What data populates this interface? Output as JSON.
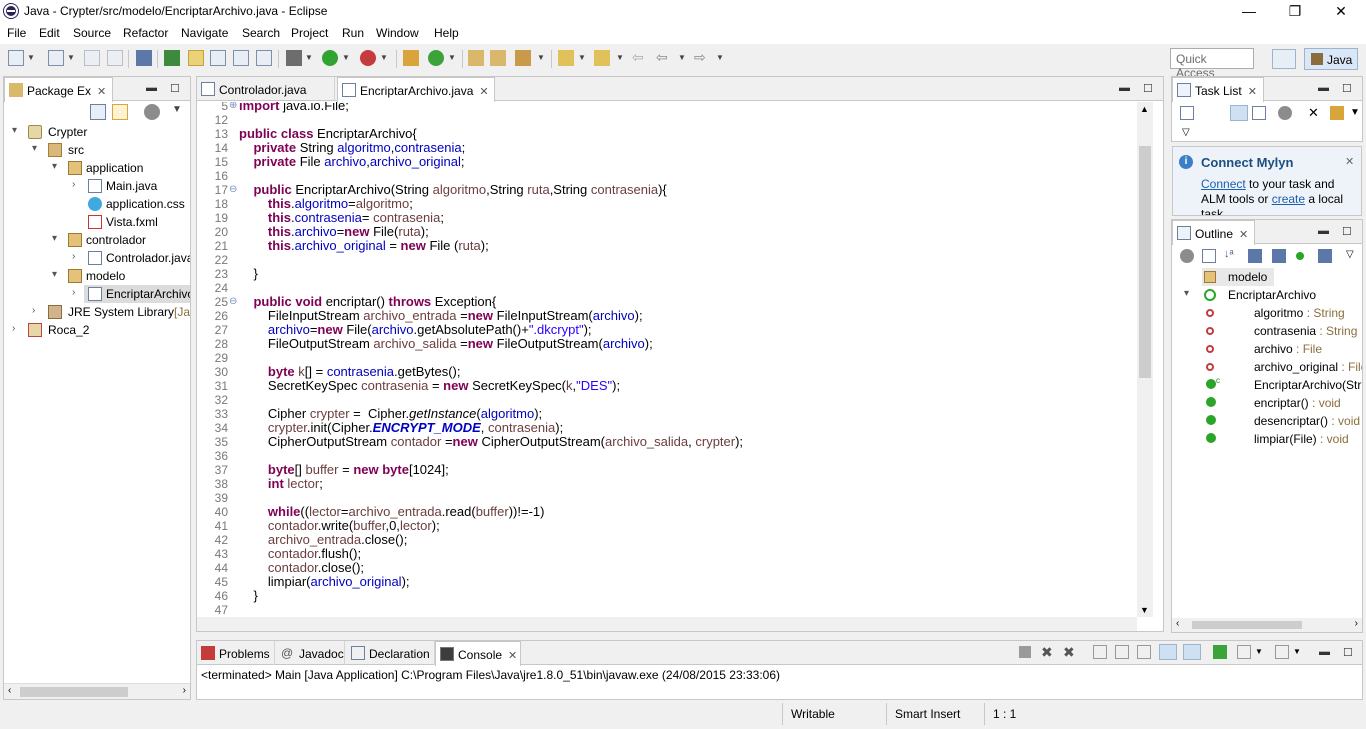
{
  "window": {
    "title": "Java - Crypter/src/modelo/EncriptarArchivo.java - Eclipse",
    "minimize": "—",
    "restore": "❐",
    "close": "✕"
  },
  "menu": [
    "File",
    "Edit",
    "Source",
    "Refactor",
    "Navigate",
    "Search",
    "Project",
    "Run",
    "Window",
    "Help"
  ],
  "quick_access": {
    "placeholder": "Quick Access"
  },
  "perspective": {
    "label": "Java"
  },
  "package_explorer": {
    "tab_label": "Package Ex",
    "tree": [
      {
        "label": "Crypter",
        "extra": "",
        "icon": "project-icon",
        "arrow": "▾"
      },
      {
        "label": "src",
        "extra": "",
        "icon": "source-folder-icon",
        "arrow": "▾"
      },
      {
        "label": "application",
        "extra": "",
        "icon": "package-icon",
        "arrow": "▾"
      },
      {
        "label": "Main.java",
        "extra": "",
        "icon": "java-file-icon",
        "arrow": "›"
      },
      {
        "label": "application.css",
        "extra": "",
        "icon": "css-file-icon",
        "arrow": ""
      },
      {
        "label": "Vista.fxml",
        "extra": "",
        "icon": "fxml-file-icon",
        "arrow": ""
      },
      {
        "label": "controlador",
        "extra": "",
        "icon": "package-icon",
        "arrow": "▾"
      },
      {
        "label": "Controlador.java",
        "extra": "",
        "icon": "java-file-icon",
        "arrow": "›"
      },
      {
        "label": "modelo",
        "extra": "",
        "icon": "package-icon",
        "arrow": "▾"
      },
      {
        "label": "EncriptarArchivo",
        "extra": "",
        "icon": "java-file-icon",
        "arrow": "›"
      },
      {
        "label": "JRE System Library",
        "extra": "[Java",
        "icon": "library-icon",
        "arrow": "›"
      },
      {
        "label": "Roca_2",
        "extra": "",
        "icon": "project-icon",
        "arrow": "›"
      }
    ]
  },
  "editor": {
    "tabs": [
      {
        "label": "Controlador.java",
        "active": false
      },
      {
        "label": "EncriptarArchivo.java",
        "active": true
      }
    ],
    "lines": [
      {
        "n": "5",
        "fold": "⊕",
        "segs": [
          [
            "kw",
            "import"
          ],
          [
            "t",
            " java.io.File;"
          ]
        ]
      },
      {
        "n": "12",
        "fold": "",
        "segs": []
      },
      {
        "n": "13",
        "fold": "",
        "segs": [
          [
            "kw",
            "public class"
          ],
          [
            "t",
            " EncriptarArchivo{"
          ]
        ]
      },
      {
        "n": "14",
        "fold": "",
        "segs": [
          [
            "t",
            "    "
          ],
          [
            "kw",
            "private"
          ],
          [
            "t",
            " String "
          ],
          [
            "fld",
            "algoritmo"
          ],
          [
            "t",
            ","
          ],
          [
            "fld",
            "contrasenia"
          ],
          [
            "t",
            ";"
          ]
        ]
      },
      {
        "n": "15",
        "fold": "",
        "segs": [
          [
            "t",
            "    "
          ],
          [
            "kw",
            "private"
          ],
          [
            "t",
            " File "
          ],
          [
            "fld",
            "archivo"
          ],
          [
            "t",
            ","
          ],
          [
            "fld",
            "archivo_original"
          ],
          [
            "t",
            ";"
          ]
        ]
      },
      {
        "n": "16",
        "fold": "",
        "segs": []
      },
      {
        "n": "17",
        "fold": "⊖",
        "segs": [
          [
            "t",
            "    "
          ],
          [
            "kw",
            "public"
          ],
          [
            "t",
            " EncriptarArchivo(String "
          ],
          [
            "prm",
            "algoritmo"
          ],
          [
            "t",
            ",String "
          ],
          [
            "prm",
            "ruta"
          ],
          [
            "t",
            ",String "
          ],
          [
            "prm",
            "contrasenia"
          ],
          [
            "t",
            "){"
          ]
        ]
      },
      {
        "n": "18",
        "fold": "",
        "segs": [
          [
            "t",
            "        "
          ],
          [
            "kw",
            "this"
          ],
          [
            "t",
            "."
          ],
          [
            "fld",
            "algoritmo"
          ],
          [
            "t",
            "="
          ],
          [
            "prm",
            "algoritmo"
          ],
          [
            "t",
            ";"
          ]
        ]
      },
      {
        "n": "19",
        "fold": "",
        "segs": [
          [
            "t",
            "        "
          ],
          [
            "kw",
            "this"
          ],
          [
            "t",
            "."
          ],
          [
            "fld",
            "contrasenia"
          ],
          [
            "t",
            "= "
          ],
          [
            "prm",
            "contrasenia"
          ],
          [
            "t",
            ";"
          ]
        ]
      },
      {
        "n": "20",
        "fold": "",
        "segs": [
          [
            "t",
            "        "
          ],
          [
            "kw",
            "this"
          ],
          [
            "t",
            "."
          ],
          [
            "fld",
            "archivo"
          ],
          [
            "t",
            "="
          ],
          [
            "kw",
            "new"
          ],
          [
            "t",
            " File("
          ],
          [
            "prm",
            "ruta"
          ],
          [
            "t",
            ");"
          ]
        ]
      },
      {
        "n": "21",
        "fold": "",
        "segs": [
          [
            "t",
            "        "
          ],
          [
            "kw",
            "this"
          ],
          [
            "t",
            "."
          ],
          [
            "fld",
            "archivo_original"
          ],
          [
            "t",
            " = "
          ],
          [
            "kw",
            "new"
          ],
          [
            "t",
            " File ("
          ],
          [
            "prm",
            "ruta"
          ],
          [
            "t",
            ");"
          ]
        ]
      },
      {
        "n": "22",
        "fold": "",
        "segs": []
      },
      {
        "n": "23",
        "fold": "",
        "segs": [
          [
            "t",
            "    }"
          ]
        ]
      },
      {
        "n": "24",
        "fold": "",
        "segs": []
      },
      {
        "n": "25",
        "fold": "⊖",
        "segs": [
          [
            "t",
            "    "
          ],
          [
            "kw",
            "public void"
          ],
          [
            "t",
            " encriptar() "
          ],
          [
            "kw",
            "throws"
          ],
          [
            "t",
            " Exception{"
          ]
        ]
      },
      {
        "n": "26",
        "fold": "",
        "segs": [
          [
            "t",
            "        FileInputStream "
          ],
          [
            "prm",
            "archivo_entrada"
          ],
          [
            "t",
            " ="
          ],
          [
            "kw",
            "new"
          ],
          [
            "t",
            " FileInputStream("
          ],
          [
            "fld",
            "archivo"
          ],
          [
            "t",
            ");"
          ]
        ]
      },
      {
        "n": "27",
        "fold": "",
        "segs": [
          [
            "t",
            "        "
          ],
          [
            "fld",
            "archivo"
          ],
          [
            "t",
            "="
          ],
          [
            "kw",
            "new"
          ],
          [
            "t",
            " File("
          ],
          [
            "fld",
            "archivo"
          ],
          [
            "t",
            ".getAbsolutePath()+"
          ],
          [
            "str",
            "\".dkcrypt\""
          ],
          [
            "t",
            ");"
          ]
        ]
      },
      {
        "n": "28",
        "fold": "",
        "segs": [
          [
            "t",
            "        FileOutputStream "
          ],
          [
            "prm",
            "archivo_salida"
          ],
          [
            "t",
            " ="
          ],
          [
            "kw",
            "new"
          ],
          [
            "t",
            " FileOutputStream("
          ],
          [
            "fld",
            "archivo"
          ],
          [
            "t",
            ");"
          ]
        ]
      },
      {
        "n": "29",
        "fold": "",
        "segs": []
      },
      {
        "n": "30",
        "fold": "",
        "segs": [
          [
            "t",
            "        "
          ],
          [
            "kw",
            "byte"
          ],
          [
            "t",
            " "
          ],
          [
            "prm",
            "k"
          ],
          [
            "t",
            "[] = "
          ],
          [
            "fld",
            "contrasenia"
          ],
          [
            "t",
            ".getBytes();"
          ]
        ]
      },
      {
        "n": "31",
        "fold": "",
        "segs": [
          [
            "t",
            "        SecretKeySpec "
          ],
          [
            "prm",
            "contrasenia"
          ],
          [
            "t",
            " = "
          ],
          [
            "kw",
            "new"
          ],
          [
            "t",
            " SecretKeySpec("
          ],
          [
            "prm",
            "k"
          ],
          [
            "t",
            ","
          ],
          [
            "str",
            "\"DES\""
          ],
          [
            "t",
            ");"
          ]
        ]
      },
      {
        "n": "32",
        "fold": "",
        "segs": []
      },
      {
        "n": "33",
        "fold": "",
        "segs": [
          [
            "t",
            "        Cipher "
          ],
          [
            "prm",
            "crypter"
          ],
          [
            "t",
            " =  Cipher."
          ],
          [
            "ital",
            "getInstance"
          ],
          [
            "t",
            "("
          ],
          [
            "fld",
            "algoritmo"
          ],
          [
            "t",
            ");"
          ]
        ]
      },
      {
        "n": "34",
        "fold": "",
        "segs": [
          [
            "t",
            "        "
          ],
          [
            "prm",
            "crypter"
          ],
          [
            "t",
            ".init(Cipher."
          ],
          [
            "sta",
            "ENCRYPT_MODE"
          ],
          [
            "t",
            ", "
          ],
          [
            "prm",
            "contrasenia"
          ],
          [
            "t",
            ");"
          ]
        ]
      },
      {
        "n": "35",
        "fold": "",
        "segs": [
          [
            "t",
            "        CipherOutputStream "
          ],
          [
            "prm",
            "contador"
          ],
          [
            "t",
            " ="
          ],
          [
            "kw",
            "new"
          ],
          [
            "t",
            " CipherOutputStream("
          ],
          [
            "prm",
            "archivo_salida"
          ],
          [
            "t",
            ", "
          ],
          [
            "prm",
            "crypter"
          ],
          [
            "t",
            ");"
          ]
        ]
      },
      {
        "n": "36",
        "fold": "",
        "segs": []
      },
      {
        "n": "37",
        "fold": "",
        "segs": [
          [
            "t",
            "        "
          ],
          [
            "kw",
            "byte"
          ],
          [
            "t",
            "[] "
          ],
          [
            "prm",
            "buffer"
          ],
          [
            "t",
            " = "
          ],
          [
            "kw",
            "new byte"
          ],
          [
            "t",
            "[1024];"
          ]
        ]
      },
      {
        "n": "38",
        "fold": "",
        "segs": [
          [
            "t",
            "        "
          ],
          [
            "kw",
            "int"
          ],
          [
            "t",
            " "
          ],
          [
            "prm",
            "lector"
          ],
          [
            "t",
            ";"
          ]
        ]
      },
      {
        "n": "39",
        "fold": "",
        "segs": []
      },
      {
        "n": "40",
        "fold": "",
        "segs": [
          [
            "t",
            "        "
          ],
          [
            "kw",
            "while"
          ],
          [
            "t",
            "(("
          ],
          [
            "prm",
            "lector"
          ],
          [
            "t",
            "="
          ],
          [
            "prm",
            "archivo_entrada"
          ],
          [
            "t",
            ".read("
          ],
          [
            "prm",
            "buffer"
          ],
          [
            "t",
            "))!=-1)"
          ]
        ]
      },
      {
        "n": "41",
        "fold": "",
        "segs": [
          [
            "t",
            "        "
          ],
          [
            "prm",
            "contador"
          ],
          [
            "t",
            ".write("
          ],
          [
            "prm",
            "buffer"
          ],
          [
            "t",
            ",0,"
          ],
          [
            "prm",
            "lector"
          ],
          [
            "t",
            ");"
          ]
        ]
      },
      {
        "n": "42",
        "fold": "",
        "segs": [
          [
            "t",
            "        "
          ],
          [
            "prm",
            "archivo_entrada"
          ],
          [
            "t",
            ".close();"
          ]
        ]
      },
      {
        "n": "43",
        "fold": "",
        "segs": [
          [
            "t",
            "        "
          ],
          [
            "prm",
            "contador"
          ],
          [
            "t",
            ".flush();"
          ]
        ]
      },
      {
        "n": "44",
        "fold": "",
        "segs": [
          [
            "t",
            "        "
          ],
          [
            "prm",
            "contador"
          ],
          [
            "t",
            ".close();"
          ]
        ]
      },
      {
        "n": "45",
        "fold": "",
        "segs": [
          [
            "t",
            "        limpiar("
          ],
          [
            "fld",
            "archivo_original"
          ],
          [
            "t",
            ");"
          ]
        ]
      },
      {
        "n": "46",
        "fold": "",
        "segs": [
          [
            "t",
            "    }"
          ]
        ]
      },
      {
        "n": "47",
        "fold": "",
        "segs": []
      }
    ]
  },
  "task_list": {
    "tab_label": "Task List"
  },
  "mylyn": {
    "title": "Connect Mylyn",
    "link1": "Connect",
    "text1": " to your task and",
    "text2": "ALM tools or ",
    "link2": "create",
    "text3": " a local",
    "text4": "task."
  },
  "outline": {
    "tab_label": "Outline",
    "items": [
      {
        "label": "modelo",
        "type": "",
        "icon": "package-icon",
        "indent": 0
      },
      {
        "label": "EncriptarArchivo",
        "type": "",
        "icon": "class-icon",
        "indent": 0
      },
      {
        "label": "algoritmo",
        "type": " : String",
        "icon": "private-field-icon",
        "indent": 1
      },
      {
        "label": "contrasenia",
        "type": " : String",
        "icon": "private-field-icon",
        "indent": 1
      },
      {
        "label": "archivo",
        "type": " : File",
        "icon": "private-field-icon",
        "indent": 1
      },
      {
        "label": "archivo_original",
        "type": " : File",
        "icon": "private-field-icon",
        "indent": 1
      },
      {
        "label": "EncriptarArchivo(Str",
        "type": "",
        "icon": "constructor-icon",
        "indent": 1
      },
      {
        "label": "encriptar()",
        "type": " : void",
        "icon": "public-method-icon",
        "indent": 1
      },
      {
        "label": "desencriptar()",
        "type": " : void",
        "icon": "public-method-icon",
        "indent": 1
      },
      {
        "label": "limpiar(File)",
        "type": " : void",
        "icon": "public-method-icon",
        "indent": 1
      }
    ]
  },
  "bottom": {
    "tabs": [
      "Problems",
      "Javadoc",
      "Declaration",
      "Console"
    ],
    "console_text": "<terminated> Main [Java Application] C:\\Program Files\\Java\\jre1.8.0_51\\bin\\javaw.exe (24/08/2015 23:33:06)"
  },
  "status": {
    "writable": "Writable",
    "insert": "Smart Insert",
    "position": "1 : 1"
  },
  "colors": {
    "keyword": "#7f0055",
    "field": "#0000c0",
    "string": "#2a00ff",
    "param": "#6a3e3e"
  }
}
